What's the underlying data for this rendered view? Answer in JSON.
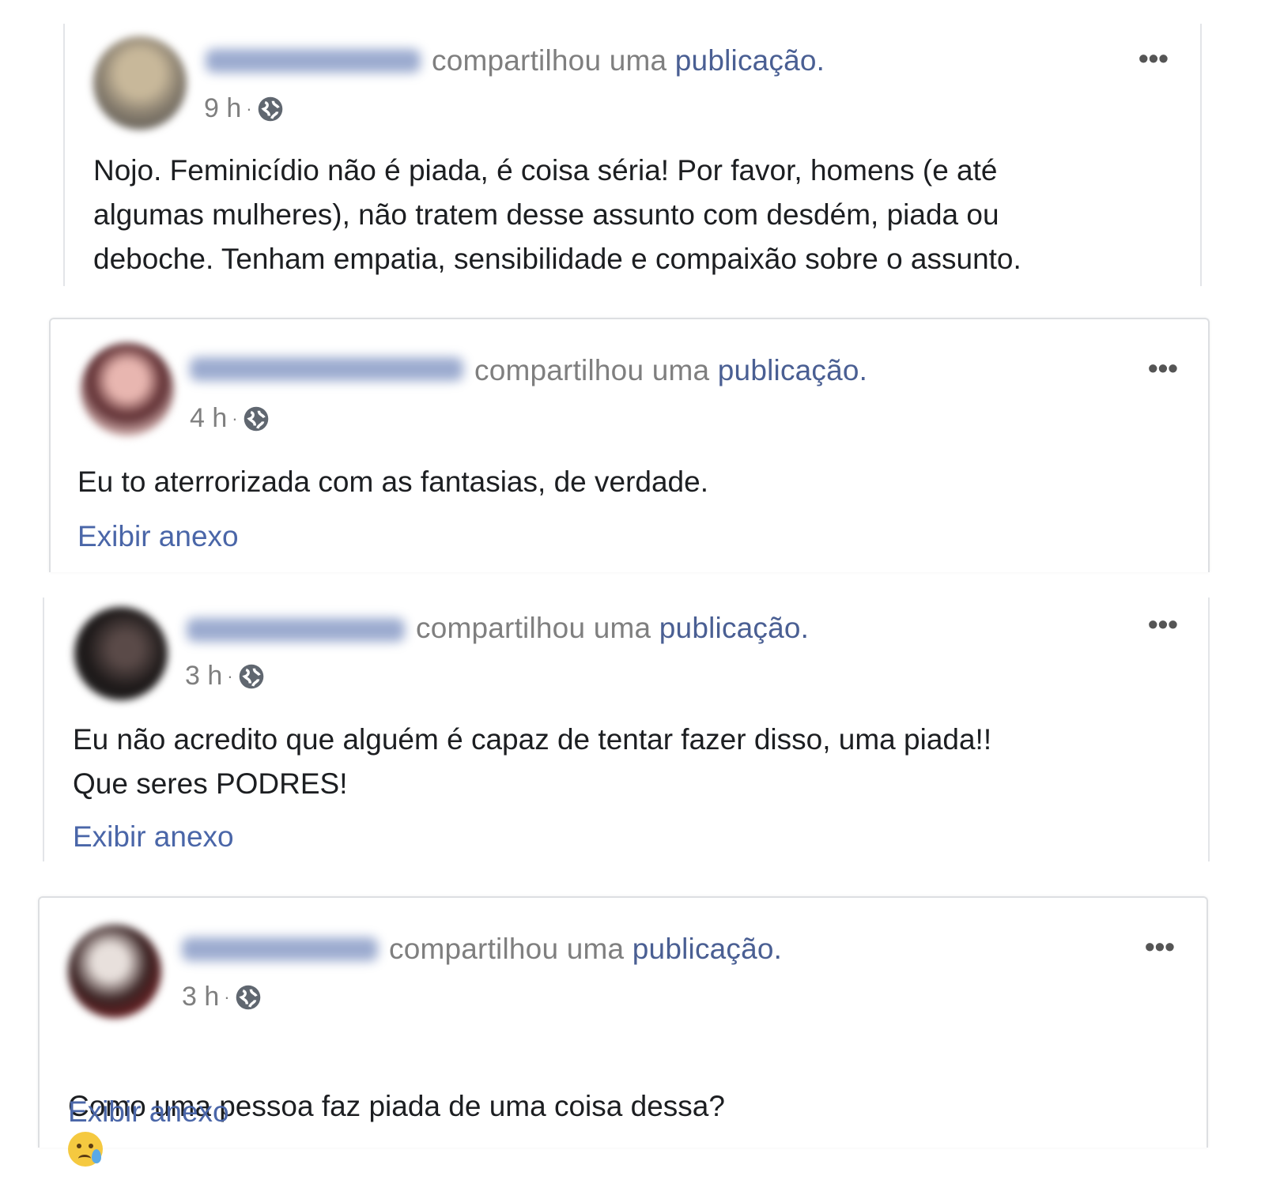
{
  "posts": [
    {
      "action": "compartilhou uma",
      "link": "publicação.",
      "time": "9 h",
      "body": "Nojo. Feminicídio não é piada, é coisa séria! Por favor, homens (e até\nalgumas mulheres), não tratem desse assunto com desdém, piada ou\ndeboche. Tenham empatia, sensibilidade e compaixão sobre o assunto.",
      "attachment": ""
    },
    {
      "action": "compartilhou uma",
      "link": "publicação.",
      "time": "4 h",
      "body": "Eu to aterrorizada com as fantasias, de verdade.",
      "attachment": "Exibir anexo"
    },
    {
      "action": "compartilhou uma",
      "link": "publicação.",
      "time": "3 h",
      "body": "Eu não acredito que alguém é capaz de tentar fazer disso, uma piada!!\nQue seres PODRES!",
      "attachment": "Exibir anexo"
    },
    {
      "action": "compartilhou uma",
      "link": "publicação.",
      "time": "3 h",
      "body": "Como uma pessoa faz piada de uma coisa dessa?",
      "attachment": "Exibir anexo",
      "emoji": "crying-face"
    }
  ],
  "more_glyph": "•••",
  "dot": "·",
  "colors": {
    "link": "#4a66a8",
    "meta": "#7f7f7f",
    "text": "#1c1e21"
  }
}
